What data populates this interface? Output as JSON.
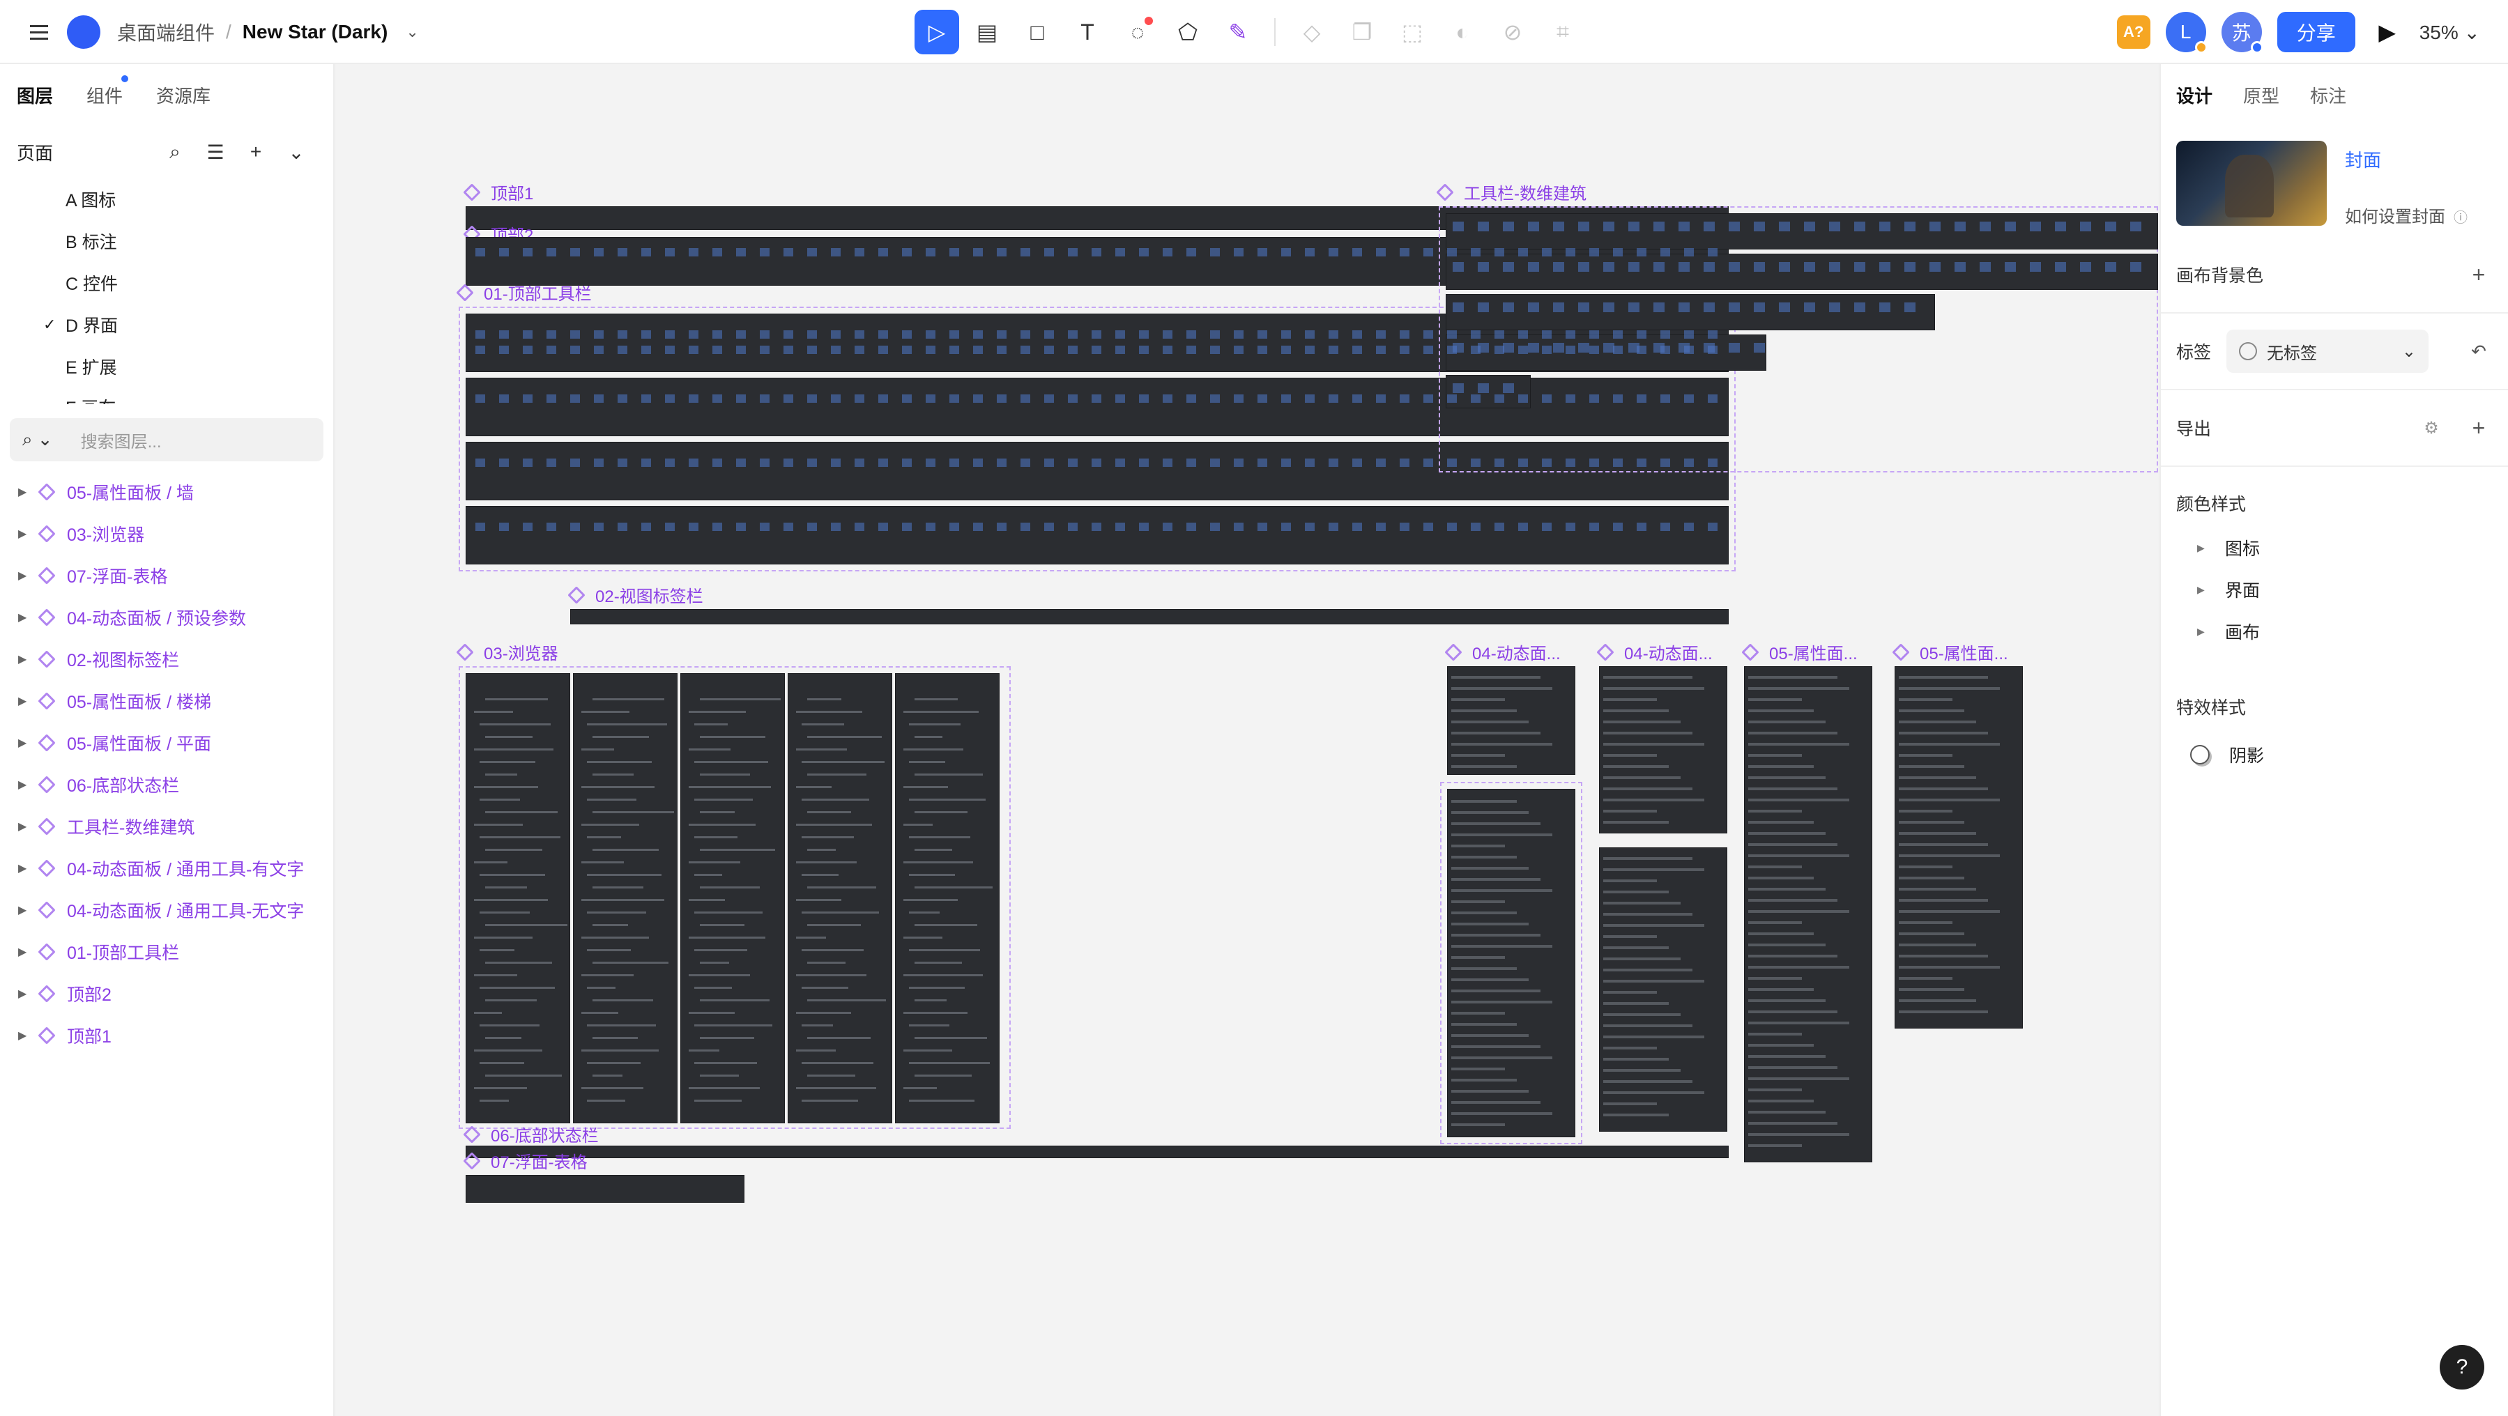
{
  "header": {
    "breadcrumb_project": "桌面端组件",
    "breadcrumb_sep": "/",
    "file_name": "New Star (Dark)",
    "file_chevron": "⌄",
    "tools": [
      {
        "name": "move-tool",
        "glyph": "▷"
      },
      {
        "name": "frame-tool",
        "glyph": "▤"
      },
      {
        "name": "rectangle-tool",
        "glyph": "□"
      },
      {
        "name": "text-tool",
        "glyph": "T"
      },
      {
        "name": "comment-tool",
        "glyph": "◌"
      },
      {
        "name": "plugin-tool",
        "glyph": "⬠"
      },
      {
        "name": "ai-tool",
        "glyph": "✎"
      }
    ],
    "secondary_tools": [
      "◇",
      "❐",
      "⬚",
      "◐",
      "⊘",
      "⌗"
    ],
    "ai_badge": "A?",
    "avatar_l": "L",
    "avatar_su": "苏",
    "share_label": "分享",
    "play_glyph": "▶",
    "zoom": "35%"
  },
  "left": {
    "tabs": [
      "图层",
      "组件",
      "资源库"
    ],
    "pages_label": "页面",
    "pages": [
      "A 图标",
      "B 标注",
      "C 控件",
      "D 界面",
      "E 扩展",
      "F 画布"
    ],
    "current_page_index": 3,
    "search_placeholder": "搜索图层...",
    "layers": [
      "05-属性面板 / 墙",
      "03-浏览器",
      "07-浮面-表格",
      "04-动态面板 / 预设参数",
      "02-视图标签栏",
      "05-属性面板 / 楼梯",
      "05-属性面板 / 平面",
      "06-底部状态栏",
      "工具栏-数维建筑",
      "04-动态面板 / 通用工具-有文字",
      "04-动态面板 / 通用工具-无文字",
      "01-顶部工具栏",
      "顶部2",
      "顶部1"
    ]
  },
  "canvas": {
    "labels": {
      "top1": "顶部1",
      "top2": "顶部2",
      "toolbar01": "01-顶部工具栏",
      "viewtabs": "02-视图标签栏",
      "browser": "03-浏览器",
      "statusbar": "06-底部状态栏",
      "table": "07-浮面-表格",
      "toolbar_arch": "工具栏-数维建筑",
      "dyn1": "04-动态面...",
      "dyn2": "04-动态面...",
      "prop1": "05-属性面...",
      "prop2": "05-属性面..."
    }
  },
  "right": {
    "tabs": [
      "设计",
      "原型",
      "标注"
    ],
    "cover_title": "封面",
    "cover_help": "如何设置封面",
    "canvas_bg_label": "画布背景色",
    "tag_label": "标签",
    "tag_value": "无标签",
    "export_label": "导出",
    "color_styles_label": "颜色样式",
    "color_styles": [
      "图标",
      "界面",
      "画布"
    ],
    "effect_styles_label": "特效样式",
    "effect_shadow": "阴影"
  },
  "help_fab": "?",
  "colors": {
    "accent": "#2f6bff",
    "layer_purple": "#8b3fe6",
    "dark_ui": "#2b2d31",
    "ai_badge": "#f6a623"
  }
}
